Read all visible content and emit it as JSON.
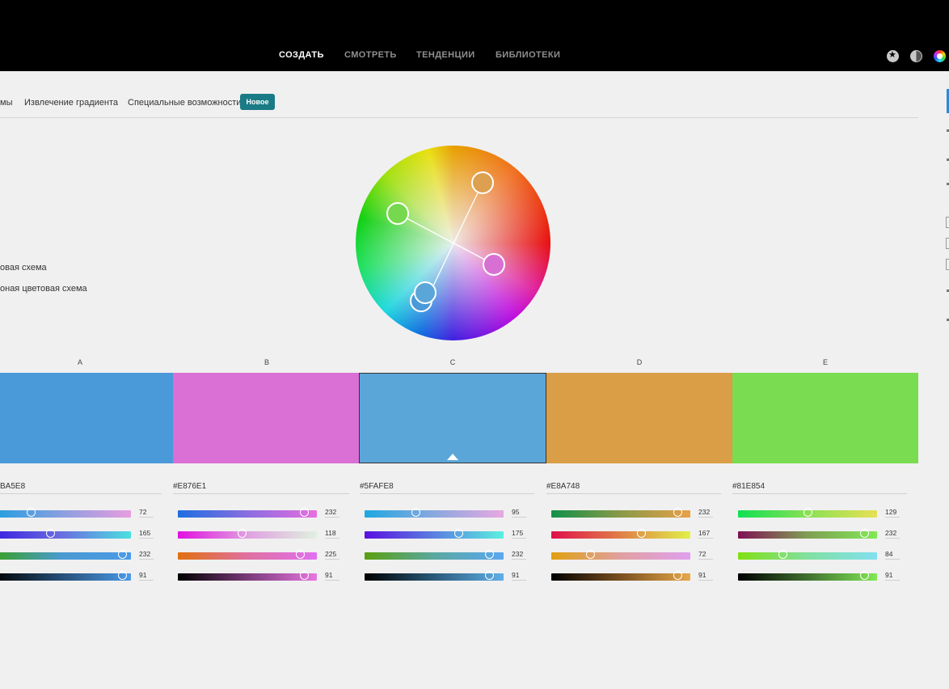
{
  "nav": {
    "items": [
      {
        "label": "СОЗДАТЬ",
        "active": true
      },
      {
        "label": "СМОТРЕТЬ",
        "active": false
      },
      {
        "label": "ТЕНДЕНЦИИ",
        "active": false
      },
      {
        "label": "БИБЛИОТЕКИ",
        "active": false
      }
    ],
    "icons": [
      "star-icon",
      "contrast-icon",
      "color-wheel-icon"
    ]
  },
  "subtabs": {
    "items": [
      "мы",
      "Извлечение градиента",
      "Специальные возможности"
    ],
    "badge": "Новое"
  },
  "schemes": {
    "items": [
      "овая схема",
      "оная цветовая схема"
    ]
  },
  "swatches": [
    {
      "label": "A",
      "color": "#4A9ADA",
      "hex_text": "BA5E8",
      "selected": false
    },
    {
      "label": "B",
      "color": "#DA6FD5",
      "hex_text": "#E876E1",
      "selected": false
    },
    {
      "label": "C",
      "color": "#5BA6D9",
      "hex_text": "#5FAFE8",
      "selected": true
    },
    {
      "label": "D",
      "color": "#DA9E47",
      "hex_text": "#E8A748",
      "selected": false
    },
    {
      "label": "E",
      "color": "#7ADC51",
      "hex_text": "#81E854",
      "selected": false
    }
  ],
  "sliders": [
    {
      "column": "A",
      "values": [
        "72",
        "165",
        "232",
        "91"
      ],
      "positions": [
        0.28,
        0.42,
        0.94,
        0.94
      ]
    },
    {
      "column": "B",
      "values": [
        "232",
        "118",
        "225",
        "91"
      ],
      "positions": [
        0.91,
        0.46,
        0.88,
        0.91
      ]
    },
    {
      "column": "C",
      "values": [
        "95",
        "175",
        "232",
        "91"
      ],
      "positions": [
        0.37,
        0.68,
        0.9,
        0.9
      ]
    },
    {
      "column": "D",
      "values": [
        "232",
        "167",
        "72",
        "91"
      ],
      "positions": [
        0.91,
        0.65,
        0.28,
        0.91
      ]
    },
    {
      "column": "E",
      "values": [
        "129",
        "232",
        "84",
        "91"
      ],
      "positions": [
        0.5,
        0.91,
        0.32,
        0.91
      ]
    }
  ]
}
